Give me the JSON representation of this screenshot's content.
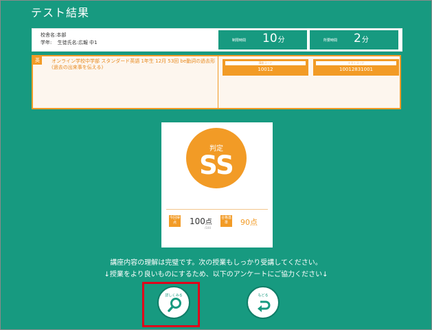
{
  "page": {
    "title": "テスト結果"
  },
  "info": {
    "school_label": "校舎名:本部",
    "grade_label": "学年:",
    "student_label": "生徒氏名:広報 中1",
    "time_limit_label": "制限時間",
    "time_limit_value": "10",
    "time_limit_unit": "分",
    "time_used_label": "所要時間",
    "time_used_value": "2",
    "time_used_unit": "分"
  },
  "course": {
    "subject_tag": "英",
    "description": "オンライン学校中学部 スタンダード英語 1年生 12月 53回 be動詞の過去形(過去の出来事を伝える)",
    "course_code_label": "講座コード",
    "course_code": "10012",
    "test_code_label": "テストコード",
    "test_code": "10012831001"
  },
  "result": {
    "judgement_label": "判定",
    "grade": "SS",
    "score_label": "今回得点",
    "score_value": "100",
    "score_unit": "点",
    "score_max": "/100",
    "pass_label": "合格基準",
    "pass_value": "90点"
  },
  "message": {
    "line1": "講座内容の理解は完璧です。次の授業もしっかり受講してください。",
    "line2": "↓授業をより良いものにするため、以下のアンケートにご協力ください↓"
  },
  "buttons": {
    "details_label": "詳しくみる",
    "back_label": "もどる"
  },
  "colors": {
    "background": "#179a80",
    "accent": "#f29b26",
    "highlight": "#e0001b"
  }
}
